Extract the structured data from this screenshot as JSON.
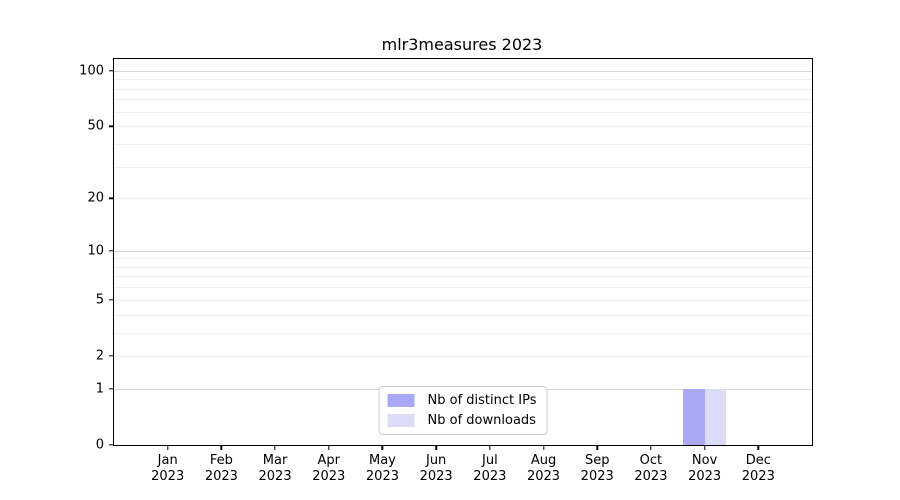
{
  "chart_data": {
    "type": "bar",
    "title": "mlr3measures 2023",
    "categories": [
      "Jan",
      "Feb",
      "Mar",
      "Apr",
      "May",
      "Jun",
      "Jul",
      "Aug",
      "Sep",
      "Oct",
      "Nov",
      "Dec"
    ],
    "category_year": "2023",
    "series": [
      {
        "name": "Nb of distinct IPs",
        "color": "#a9a9f7",
        "values": [
          0,
          0,
          0,
          0,
          0,
          0,
          0,
          0,
          0,
          0,
          1,
          0
        ]
      },
      {
        "name": "Nb of downloads",
        "color": "#dcdcf9",
        "values": [
          0,
          0,
          0,
          0,
          0,
          0,
          0,
          0,
          0,
          0,
          1,
          0
        ]
      }
    ],
    "xlabel": "",
    "ylabel": "",
    "bar_width_fraction": 0.4,
    "yaxis": {
      "scale": "log1p",
      "ylim": [
        0,
        116
      ],
      "tick_values": [
        0,
        1,
        2,
        5,
        10,
        20,
        50,
        100
      ],
      "major_gridlines": [
        1,
        10,
        100
      ],
      "minor_gridlines": [
        2,
        3,
        4,
        5,
        6,
        7,
        8,
        9,
        20,
        30,
        40,
        50,
        60,
        70,
        80,
        90
      ],
      "grid": true
    },
    "legend": {
      "position": "lower center",
      "border_color": "#cccccc"
    },
    "colors": {
      "grid_major": "#d6d6d6",
      "grid_minor": "#f1f1f1",
      "spine": "#000000",
      "text": "#000000"
    }
  }
}
